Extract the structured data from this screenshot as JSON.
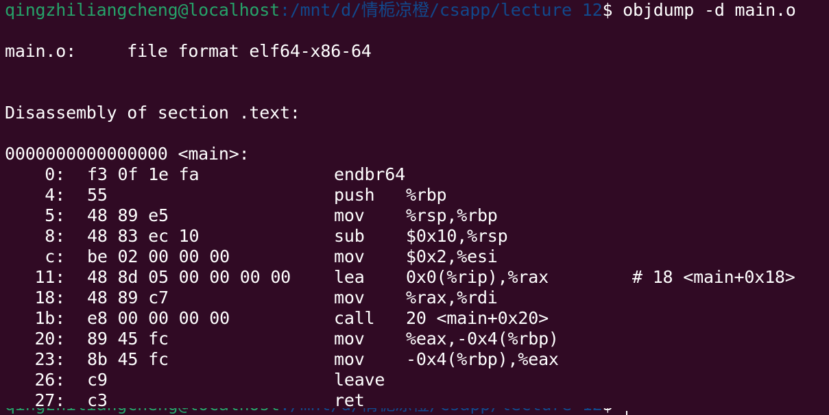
{
  "prompt": {
    "user_host": "qingzhiliangcheng@localhost",
    "path": ":/mnt/d/情栀凉橙/csapp/lecture 12",
    "symbol": "$",
    "command": " objdump -d main.o"
  },
  "file_format_line": "main.o:     file format elf64-x86-64",
  "section_line": "Disassembly of section .text:",
  "symbol_line": "0000000000000000 <main>:",
  "instructions": [
    {
      "addr": "0:",
      "bytes": "f3 0f 1e fa",
      "mnemonic": "endbr64",
      "operands": "",
      "comment": ""
    },
    {
      "addr": "4:",
      "bytes": "55",
      "mnemonic": "push",
      "operands": "%rbp",
      "comment": ""
    },
    {
      "addr": "5:",
      "bytes": "48 89 e5",
      "mnemonic": "mov",
      "operands": "%rsp,%rbp",
      "comment": ""
    },
    {
      "addr": "8:",
      "bytes": "48 83 ec 10",
      "mnemonic": "sub",
      "operands": "$0x10,%rsp",
      "comment": ""
    },
    {
      "addr": "c:",
      "bytes": "be 02 00 00 00",
      "mnemonic": "mov",
      "operands": "$0x2,%esi",
      "comment": ""
    },
    {
      "addr": "11:",
      "bytes": "48 8d 05 00 00 00 00",
      "mnemonic": "lea",
      "operands": "0x0(%rip),%rax",
      "comment": "# 18 <main+0x18>"
    },
    {
      "addr": "18:",
      "bytes": "48 89 c7",
      "mnemonic": "mov",
      "operands": "%rax,%rdi",
      "comment": ""
    },
    {
      "addr": "1b:",
      "bytes": "e8 00 00 00 00",
      "mnemonic": "call",
      "operands": "20 <main+0x20>",
      "comment": ""
    },
    {
      "addr": "20:",
      "bytes": "89 45 fc",
      "mnemonic": "mov",
      "operands": "%eax,-0x4(%rbp)",
      "comment": ""
    },
    {
      "addr": "23:",
      "bytes": "8b 45 fc",
      "mnemonic": "mov",
      "operands": "-0x4(%rbp),%eax",
      "comment": ""
    },
    {
      "addr": "26:",
      "bytes": "c9",
      "mnemonic": "leave",
      "operands": "",
      "comment": ""
    },
    {
      "addr": "27:",
      "bytes": "c3",
      "mnemonic": "ret",
      "operands": "",
      "comment": ""
    }
  ],
  "colors": {
    "background": "#300a24",
    "foreground": "#ffffff",
    "user_host": "#26a269",
    "path": "#12488b"
  }
}
